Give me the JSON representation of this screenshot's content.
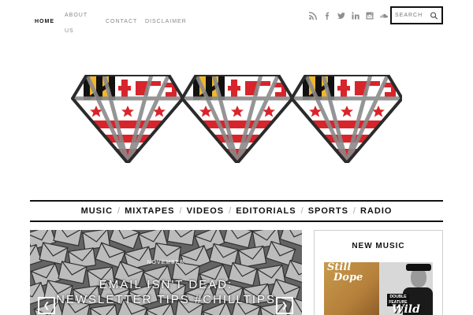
{
  "topnav": {
    "home": "HOME",
    "about": "ABOUT US",
    "contact": "CONTACT",
    "disclaimer": "DISCLAIMER"
  },
  "social_icons": [
    "rss-icon",
    "facebook-icon",
    "twitter-icon",
    "linkedin-icon",
    "instagram-icon",
    "soundcloud-icon"
  ],
  "search": {
    "placeholder": "SEARCH"
  },
  "menu": [
    "MUSIC",
    "MIXTAPES",
    "VIDEOS",
    "EDITORIALS",
    "SPORTS",
    "RADIO"
  ],
  "feature": {
    "meta": "NOVEMBER",
    "title_line1": "EMAIL ISN'T DEAD:",
    "title_line2": "NEWSLETTER TIPS #CHILLTIPS"
  },
  "sidebar": {
    "heading": "NEW MUSIC",
    "cover": {
      "text1": "Still",
      "text2": "Dope",
      "badge": "DOUBLE FEATURE",
      "text3": "Wild"
    }
  },
  "colors": {
    "accent": "#111111",
    "flag_red": "#d8242b",
    "flag_gold": "#f1b62b",
    "logo_outline": "#2b2b2b"
  }
}
